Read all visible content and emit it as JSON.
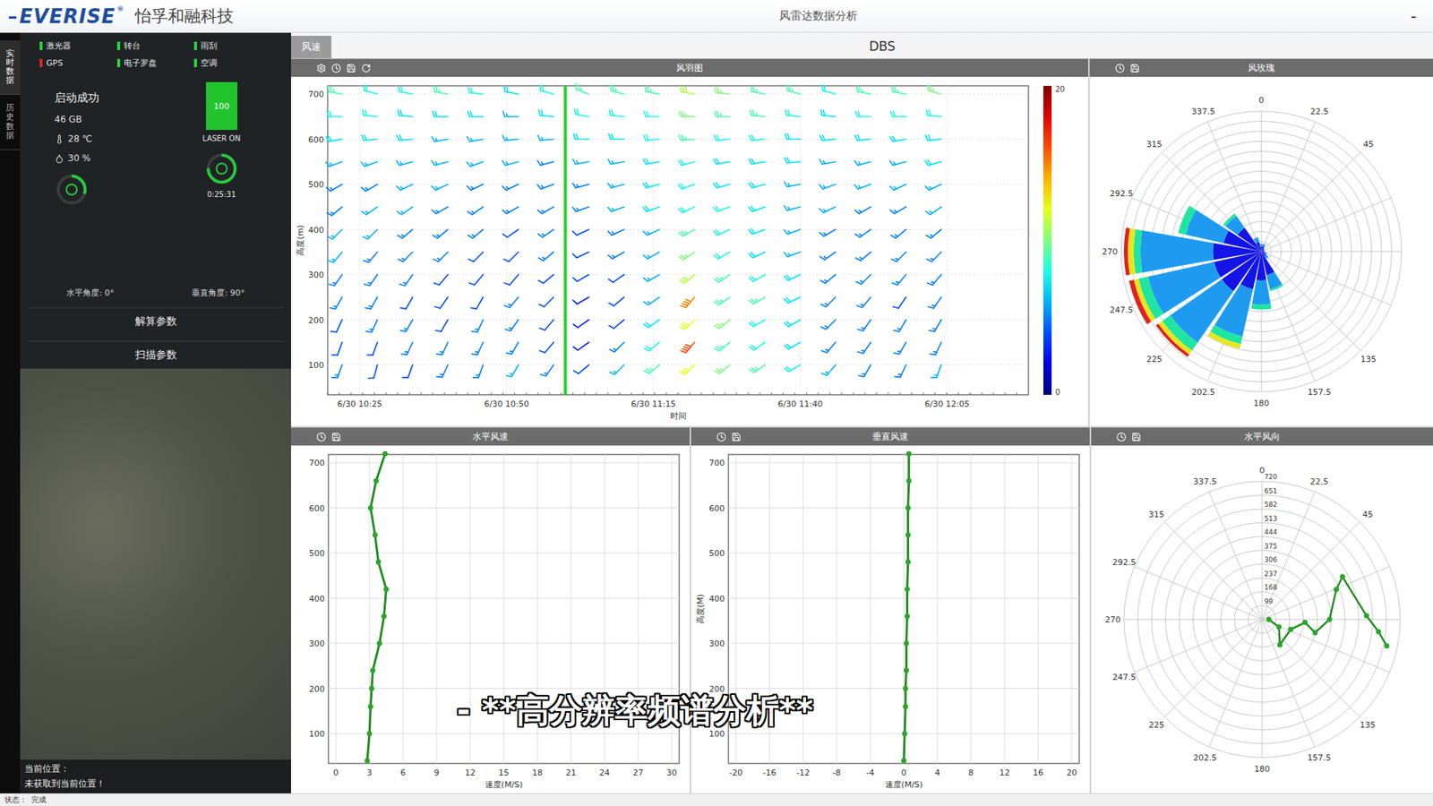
{
  "header": {
    "logo": "EVERISE",
    "logo_mark": "®",
    "company": "怡孚和融科技",
    "title": "风雷达数据分析",
    "minimize": "-"
  },
  "side_tabs": [
    {
      "label": "实时数据",
      "selected": true
    },
    {
      "label": "历史数据",
      "selected": false
    }
  ],
  "device": {
    "indicators": [
      {
        "label": "激光器",
        "ok": true
      },
      {
        "label": "转台",
        "ok": true
      },
      {
        "label": "雨刮",
        "ok": true
      },
      {
        "label": "GPS",
        "ok": false
      },
      {
        "label": "电子罗盘",
        "ok": true
      },
      {
        "label": "空调",
        "ok": true
      }
    ],
    "status": "启动成功",
    "storage": "46 GB",
    "temperature": "28 ℃",
    "humidity": "30 %",
    "laser": {
      "value": "100",
      "label": "LASER ON",
      "level": 1
    },
    "timer": "0:25:31",
    "gauges": [
      {
        "level": 0.75
      },
      {
        "level": 0.3
      }
    ],
    "horizontal_angle": "水平角度: 0°",
    "vertical_angle": "垂直角度: 90°",
    "sections": [
      "解算参数",
      "扫描参数"
    ]
  },
  "location": {
    "label": "当前位置：",
    "value": "未获取到当前位置！"
  },
  "status_bar": {
    "label": "状态：",
    "value": "完成"
  },
  "main_tabs": [
    {
      "label": "风速",
      "selected": true
    }
  ],
  "mode": "DBS",
  "barb_chart": {
    "title": "风羽图",
    "x_title": "时间",
    "y_title": "高度(m)",
    "x_ticks": [
      "6/30 10:25",
      "6/30 10:50",
      "6/30 11:15",
      "6/30 11:40",
      "6/30 12:05"
    ],
    "y_ticks": [
      "100",
      "200",
      "300",
      "400",
      "500",
      "600",
      "700"
    ],
    "colorbar": {
      "max": "20",
      "min": "0"
    },
    "cursor_minute": 35,
    "heights": [
      100,
      150,
      200,
      250,
      300,
      350,
      400,
      450,
      500,
      550,
      600,
      650,
      700
    ],
    "columns": [
      {
        "minute": -3,
        "speeds": [
          5,
          4,
          4,
          5,
          5,
          6,
          6,
          5,
          5,
          6,
          7,
          8,
          9
        ],
        "directions": [
          200,
          200,
          205,
          210,
          215,
          220,
          225,
          230,
          240,
          250,
          260,
          270,
          280
        ]
      },
      {
        "minute": 3,
        "speeds": [
          4,
          4,
          5,
          5,
          5,
          5,
          6,
          6,
          5,
          6,
          7,
          8,
          8
        ],
        "directions": [
          195,
          200,
          205,
          210,
          215,
          220,
          225,
          235,
          240,
          250,
          265,
          275,
          285
        ]
      },
      {
        "minute": 9,
        "speeds": [
          4,
          5,
          5,
          4,
          5,
          5,
          5,
          6,
          6,
          6,
          7,
          7,
          8
        ],
        "directions": [
          200,
          205,
          210,
          210,
          215,
          225,
          230,
          235,
          245,
          255,
          265,
          275,
          280
        ]
      },
      {
        "minute": 15,
        "speeds": [
          5,
          5,
          4,
          4,
          4,
          5,
          5,
          5,
          6,
          6,
          6,
          7,
          9
        ],
        "directions": [
          205,
          205,
          210,
          215,
          220,
          225,
          230,
          240,
          245,
          255,
          260,
          270,
          280
        ]
      },
      {
        "minute": 21,
        "speeds": [
          5,
          5,
          5,
          4,
          4,
          4,
          5,
          5,
          5,
          6,
          6,
          7,
          8
        ],
        "directions": [
          200,
          205,
          205,
          210,
          220,
          225,
          230,
          235,
          245,
          250,
          260,
          270,
          275
        ]
      },
      {
        "minute": 27,
        "speeds": [
          6,
          5,
          5,
          5,
          4,
          4,
          4,
          5,
          5,
          6,
          6,
          6,
          7
        ],
        "directions": [
          210,
          210,
          215,
          220,
          220,
          225,
          235,
          240,
          245,
          255,
          265,
          270,
          280
        ]
      },
      {
        "minute": 33,
        "speeds": [
          5,
          4,
          4,
          4,
          4,
          5,
          5,
          5,
          5,
          5,
          6,
          7,
          8
        ],
        "directions": [
          215,
          220,
          220,
          225,
          230,
          230,
          235,
          240,
          250,
          255,
          265,
          275,
          285
        ]
      },
      {
        "minute": 39,
        "speeds": [
          4,
          3,
          3,
          3,
          4,
          4,
          4,
          5,
          5,
          6,
          7,
          8,
          9
        ],
        "directions": [
          230,
          235,
          235,
          240,
          240,
          245,
          245,
          250,
          255,
          260,
          270,
          280,
          290
        ]
      },
      {
        "minute": 45,
        "speeds": [
          6,
          5,
          4,
          4,
          4,
          5,
          5,
          6,
          6,
          6,
          7,
          8,
          9
        ],
        "directions": [
          225,
          225,
          230,
          230,
          235,
          240,
          245,
          250,
          255,
          260,
          270,
          275,
          285
        ]
      },
      {
        "minute": 51,
        "speeds": [
          9,
          8,
          7,
          6,
          6,
          6,
          6,
          7,
          7,
          7,
          8,
          8,
          9
        ],
        "directions": [
          230,
          230,
          235,
          235,
          240,
          240,
          245,
          250,
          255,
          260,
          265,
          270,
          280
        ]
      },
      {
        "minute": 57,
        "speeds": [
          12,
          16,
          12,
          15,
          11,
          10,
          9,
          8,
          8,
          8,
          9,
          10,
          11
        ],
        "directions": [
          225,
          220,
          225,
          220,
          230,
          235,
          240,
          245,
          250,
          255,
          265,
          270,
          280
        ]
      },
      {
        "minute": 63,
        "speeds": [
          10,
          9,
          10,
          9,
          9,
          8,
          8,
          8,
          7,
          7,
          8,
          9,
          10
        ],
        "directions": [
          230,
          230,
          230,
          235,
          235,
          240,
          245,
          250,
          255,
          260,
          265,
          270,
          275
        ]
      },
      {
        "minute": 69,
        "speeds": [
          9,
          8,
          8,
          9,
          8,
          7,
          7,
          7,
          7,
          7,
          8,
          9,
          9
        ],
        "directions": [
          235,
          235,
          240,
          240,
          240,
          245,
          250,
          250,
          255,
          260,
          265,
          275,
          280
        ]
      },
      {
        "minute": 75,
        "speeds": [
          8,
          7,
          7,
          7,
          7,
          6,
          6,
          6,
          6,
          7,
          7,
          8,
          9
        ],
        "directions": [
          240,
          240,
          240,
          245,
          245,
          250,
          250,
          255,
          260,
          265,
          270,
          275,
          285
        ]
      },
      {
        "minute": 81,
        "speeds": [
          6,
          5,
          5,
          5,
          5,
          5,
          5,
          6,
          6,
          6,
          7,
          7,
          8
        ],
        "directions": [
          220,
          220,
          225,
          225,
          230,
          235,
          240,
          245,
          250,
          260,
          265,
          275,
          285
        ]
      },
      {
        "minute": 87,
        "speeds": [
          5,
          5,
          5,
          5,
          5,
          5,
          5,
          5,
          6,
          6,
          7,
          8,
          9
        ],
        "directions": [
          210,
          215,
          215,
          220,
          225,
          230,
          235,
          240,
          250,
          255,
          265,
          270,
          280
        ]
      },
      {
        "minute": 93,
        "speeds": [
          5,
          5,
          5,
          4,
          5,
          5,
          5,
          5,
          6,
          6,
          7,
          8,
          9
        ],
        "directions": [
          205,
          210,
          210,
          215,
          220,
          225,
          230,
          240,
          245,
          255,
          260,
          270,
          280
        ]
      },
      {
        "minute": 99,
        "speeds": [
          6,
          5,
          5,
          5,
          5,
          5,
          5,
          6,
          6,
          7,
          7,
          8,
          10
        ],
        "directions": [
          200,
          205,
          210,
          215,
          220,
          225,
          230,
          235,
          245,
          255,
          265,
          275,
          285
        ]
      }
    ]
  },
  "wind_rose": {
    "title": "风玫瑰",
    "angle_labels": [
      "337.5",
      "0",
      "22.5",
      "45",
      "135",
      "157.5",
      "180",
      "202.5",
      "225",
      "247.5",
      "270",
      "292.5",
      "315"
    ],
    "bins": [
      {
        "color": "#1414e6"
      },
      {
        "color": "#1e9bf0"
      },
      {
        "color": "#1ee6a0"
      },
      {
        "color": "#e6e61e"
      },
      {
        "color": "#e61e1e"
      }
    ],
    "sectors": [
      {
        "direction": 0,
        "values": [
          0.5,
          0.3,
          0,
          0,
          0
        ]
      },
      {
        "direction": 22.5,
        "values": [
          0.6,
          0.2,
          0,
          0,
          0
        ]
      },
      {
        "direction": 45,
        "values": [
          0.4,
          0,
          0,
          0,
          0
        ]
      },
      {
        "direction": 67.5,
        "values": [
          0.3,
          0,
          0,
          0,
          0
        ]
      },
      {
        "direction": 90,
        "values": [
          0.3,
          0,
          0,
          0,
          0
        ]
      },
      {
        "direction": 112.5,
        "values": [
          0.4,
          0.2,
          0,
          0,
          0
        ]
      },
      {
        "direction": 135,
        "values": [
          0.6,
          0.3,
          0,
          0,
          0
        ]
      },
      {
        "direction": 157.5,
        "values": [
          2.5,
          1.5,
          0.2,
          0,
          0
        ]
      },
      {
        "direction": 180,
        "values": [
          3,
          2.5,
          0.5,
          0,
          0
        ]
      },
      {
        "direction": 202.5,
        "values": [
          4,
          5,
          0.8,
          0.5,
          0
        ]
      },
      {
        "direction": 225,
        "values": [
          5,
          6.5,
          1,
          0.5,
          0.3
        ]
      },
      {
        "direction": 247.5,
        "values": [
          5,
          7,
          1,
          0.5,
          0.5
        ]
      },
      {
        "direction": 270,
        "values": [
          5,
          7.5,
          0.7,
          0.6,
          0.4
        ]
      },
      {
        "direction": 292.5,
        "values": [
          4,
          4,
          0.8,
          0,
          0
        ]
      },
      {
        "direction": 315,
        "values": [
          3,
          1.5,
          0.3,
          0,
          0
        ]
      },
      {
        "direction": 337.5,
        "values": [
          1,
          0.5,
          0,
          0,
          0
        ]
      }
    ]
  },
  "h_speed": {
    "title": "水平风速",
    "x_title": "速度(M/S)",
    "x_ticks": [
      "0",
      "3",
      "6",
      "9",
      "12",
      "15",
      "18",
      "21",
      "24",
      "27",
      "30"
    ],
    "y_ticks": [
      "100",
      "200",
      "300",
      "400",
      "500",
      "600",
      "700"
    ],
    "heights": [
      40,
      100,
      160,
      200,
      240,
      300,
      360,
      420,
      480,
      540,
      600,
      660,
      720
    ],
    "values": [
      2.8,
      3.0,
      3.1,
      3.2,
      3.3,
      3.9,
      4.3,
      4.5,
      3.8,
      3.5,
      3.1,
      3.6,
      4.4
    ]
  },
  "v_speed": {
    "title": "垂直风速",
    "x_title": "速度(M/S)",
    "y_title": "高度(M)",
    "x_ticks": [
      "-20",
      "-16",
      "-12",
      "-8",
      "-4",
      "0",
      "4",
      "8",
      "12",
      "16",
      "20"
    ],
    "y_ticks": [
      "100",
      "200",
      "300",
      "400",
      "500",
      "600",
      "700"
    ],
    "heights": [
      40,
      100,
      160,
      200,
      240,
      300,
      360,
      420,
      480,
      540,
      600,
      660,
      720
    ],
    "values": [
      0.0,
      0.1,
      0.2,
      0.2,
      0.3,
      0.3,
      0.4,
      0.4,
      0.5,
      0.5,
      0.5,
      0.6,
      0.6
    ]
  },
  "h_direction": {
    "title": "水平风向",
    "angle_labels": [
      "337.5",
      "0",
      "22.5",
      "45",
      "135",
      "157.5",
      "180",
      "202.5",
      "225",
      "247.5",
      "270",
      "292.5",
      "315"
    ],
    "ring_labels": [
      "720",
      "651",
      "582",
      "513",
      "444",
      "375",
      "306",
      "237",
      "168",
      "99"
    ],
    "heights": [
      64,
      122,
      185,
      182,
      245,
      303,
      367,
      430,
      485,
      552,
      615,
      667
    ],
    "directions": [
      90,
      114,
      145,
      109,
      94,
      104,
      90,
      68,
      62,
      88,
      96,
      102
    ]
  },
  "caption": "- **高分辨率频谱分析**"
}
